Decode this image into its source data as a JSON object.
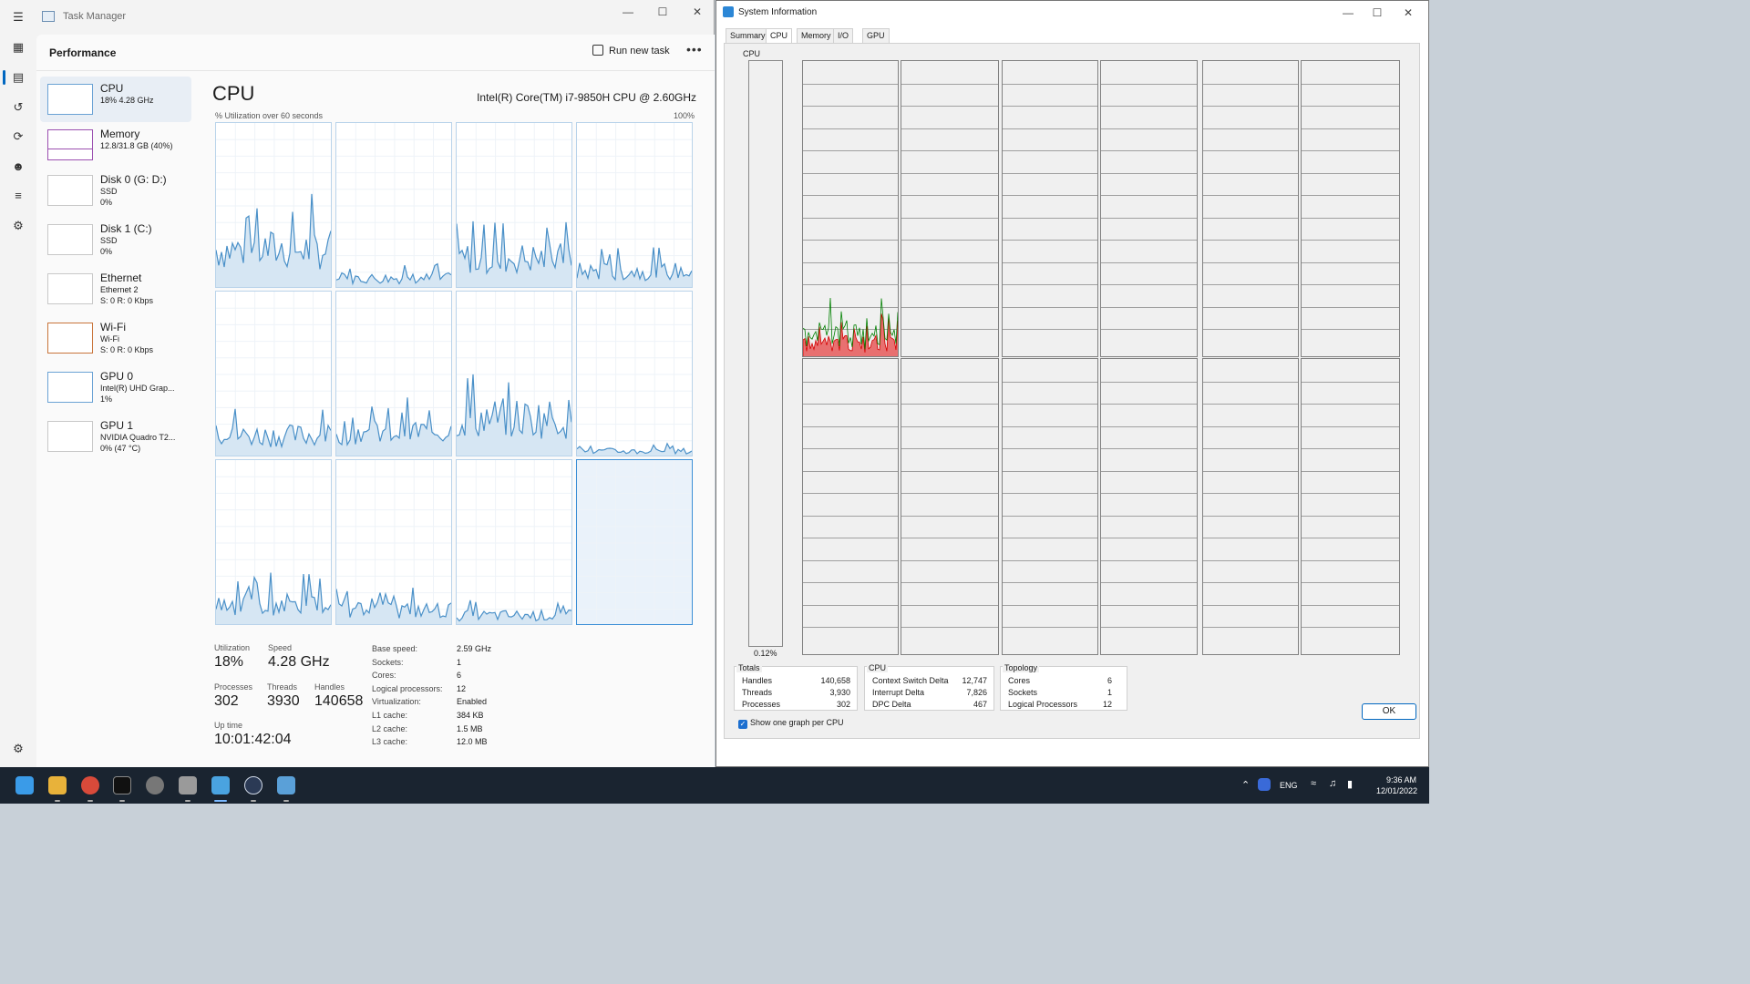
{
  "task_manager": {
    "title": "Task Manager",
    "page_title": "Performance",
    "run_new_task": "Run new task",
    "more": "•••",
    "sidebar": [
      {
        "name": "CPU",
        "sub1": "18% 4.28 GHz",
        "sub2": ""
      },
      {
        "name": "Memory",
        "sub1": "12.8/31.8 GB (40%)",
        "sub2": ""
      },
      {
        "name": "Disk 0 (G: D:)",
        "sub1": "SSD",
        "sub2": "0%"
      },
      {
        "name": "Disk 1 (C:)",
        "sub1": "SSD",
        "sub2": "0%"
      },
      {
        "name": "Ethernet",
        "sub1": "Ethernet 2",
        "sub2": "S: 0 R: 0 Kbps"
      },
      {
        "name": "Wi-Fi",
        "sub1": "Wi-Fi",
        "sub2": "S: 0 R: 0 Kbps"
      },
      {
        "name": "GPU 0",
        "sub1": "Intel(R) UHD Grap...",
        "sub2": "1%"
      },
      {
        "name": "GPU 1",
        "sub1": "NVIDIA Quadro T2...",
        "sub2": "0% (47 °C)"
      }
    ],
    "main": {
      "heading": "CPU",
      "model": "Intel(R) Core(TM) i7-9850H CPU @ 2.60GHz",
      "util_label": "% Utilization over 60 seconds",
      "max_label": "100%",
      "stats": {
        "utilization_label": "Utilization",
        "utilization": "18%",
        "speed_label": "Speed",
        "speed": "4.28 GHz",
        "processes_label": "Processes",
        "processes": "302",
        "threads_label": "Threads",
        "threads": "3930",
        "handles_label": "Handles",
        "handles": "140658",
        "uptime_label": "Up time",
        "uptime": "10:01:42:04"
      },
      "details": [
        {
          "k": "Base speed:",
          "v": "2.59 GHz"
        },
        {
          "k": "Sockets:",
          "v": "1"
        },
        {
          "k": "Cores:",
          "v": "6"
        },
        {
          "k": "Logical processors:",
          "v": "12"
        },
        {
          "k": "Virtualization:",
          "v": "Enabled"
        },
        {
          "k": "L1 cache:",
          "v": "384 KB"
        },
        {
          "k": "L2 cache:",
          "v": "1.5 MB"
        },
        {
          "k": "L3 cache:",
          "v": "12.0 MB"
        }
      ]
    }
  },
  "system_information": {
    "title": "System Information",
    "tabs": [
      "Summary",
      "CPU",
      "Memory",
      "I/O",
      "GPU"
    ],
    "selected_tab": "CPU",
    "cpu_label": "CPU",
    "total_pct": "0.12%",
    "totals": {
      "title": "Totals",
      "rows": [
        {
          "k": "Handles",
          "v": "140,658"
        },
        {
          "k": "Threads",
          "v": "3,930"
        },
        {
          "k": "Processes",
          "v": "302"
        }
      ]
    },
    "cpu_group": {
      "title": "CPU",
      "rows": [
        {
          "k": "Context Switch Delta",
          "v": "12,747"
        },
        {
          "k": "Interrupt Delta",
          "v": "7,826"
        },
        {
          "k": "DPC Delta",
          "v": "467"
        }
      ]
    },
    "topology": {
      "title": "Topology",
      "rows": [
        {
          "k": "Cores",
          "v": "6"
        },
        {
          "k": "Sockets",
          "v": "1"
        },
        {
          "k": "Logical Processors",
          "v": "12"
        }
      ]
    },
    "checkbox_label": "Show one graph per CPU",
    "ok_label": "OK",
    "colors": {
      "kernel": "#d40000",
      "user": "#008000"
    }
  },
  "taskbar": {
    "language": "ENG",
    "time": "9:36 AM",
    "date": "12/01/2022"
  },
  "colors": {
    "accent": "#0067c0",
    "graph_line": "#4a90c8",
    "graph_fill": "#d6e6f3"
  }
}
